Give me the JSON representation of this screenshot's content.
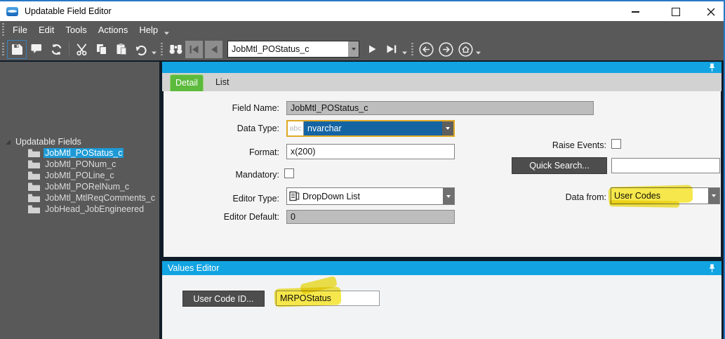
{
  "window": {
    "title": "Updatable Field Editor",
    "accent_color": "#2678C6"
  },
  "menu": {
    "items": [
      "File",
      "Edit",
      "Tools",
      "Actions",
      "Help"
    ]
  },
  "toolbar": {
    "record_selector_value": "JobMtl_POStatus_c",
    "icons": [
      "save",
      "comment",
      "refresh",
      "cut",
      "copy",
      "paste",
      "undo",
      "find",
      "first-record",
      "previous-record",
      "next-record",
      "last-record",
      "navigate-back",
      "navigate-forward",
      "home"
    ]
  },
  "left_panel": {
    "root_label": "Updatable Fields",
    "items": [
      "JobMtl_POStatus_c",
      "JobMtl_PONum_c",
      "JobMtl_POLine_c",
      "JobMtl_PORelNum_c",
      "JobMtl_MtlReqComments_c",
      "JobHead_JobEngineered"
    ],
    "selected_index": 0
  },
  "main_panel": {
    "tabs": [
      {
        "label": "Detail",
        "active": true
      },
      {
        "label": "List",
        "active": false
      }
    ],
    "form": {
      "field_name": {
        "label": "Field Name:",
        "value": "JobMtl_POStatus_c",
        "readonly": true
      },
      "data_type": {
        "label": "Data Type:",
        "value": "nvarchar",
        "type_badge": "abc"
      },
      "format": {
        "label": "Format:",
        "value": "x(200)"
      },
      "mandatory": {
        "label": "Mandatory:",
        "checked": false
      },
      "editor_type": {
        "label": "Editor Type:",
        "value": "DropDown List"
      },
      "editor_default": {
        "label": "Editor Default:",
        "value": "0",
        "readonly": true
      },
      "raise_events": {
        "label": "Raise Events:",
        "checked": false
      },
      "quick_search": {
        "button_label": "Quick Search...",
        "value": ""
      },
      "data_from": {
        "label": "Data from:",
        "value": "User Codes",
        "highlighted": true
      }
    }
  },
  "values_editor": {
    "title": "Values Editor",
    "user_code_button_label": "User Code ID...",
    "user_code_value": "MRPOStatus",
    "highlighted": true
  },
  "colors": {
    "header_cyan": "#12A4E2",
    "panel_gray": "#595959",
    "window_inner_navy": "#101C28",
    "selection_blue": "#1464A4",
    "tree_selected_blue": "#1E9AD6",
    "tab_green": "#5CBA3C",
    "highlight_yellow": "#F3E224",
    "focus_border_gold": "#DFA926",
    "disabled_field_gray": "#BDBDBD"
  }
}
